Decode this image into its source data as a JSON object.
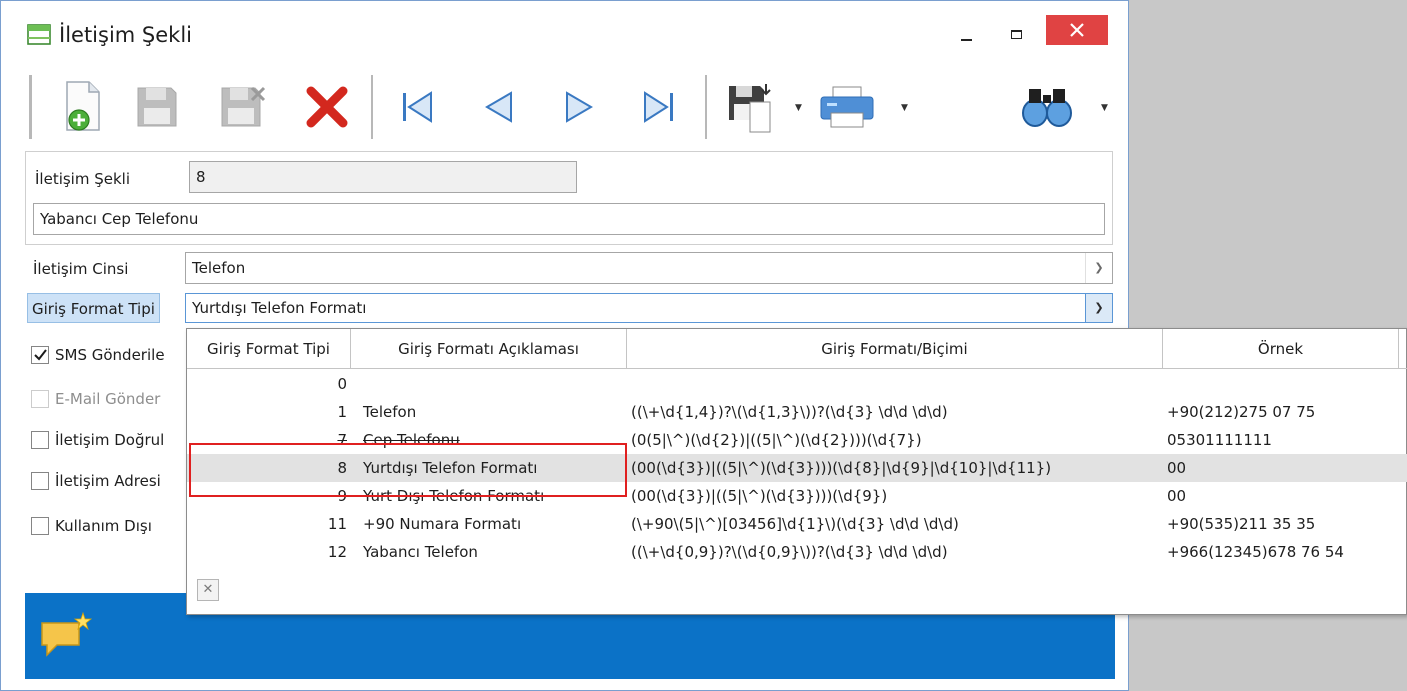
{
  "window": {
    "title": "İletişim Şekli",
    "buttons": {
      "minimize": "_",
      "maximize": "□",
      "close": "✕"
    }
  },
  "toolbar": {
    "items": [
      "new-icon",
      "save-icon",
      "save-close-icon",
      "delete-icon",
      "first-record-icon",
      "previous-record-icon",
      "next-record-icon",
      "last-record-icon",
      "export-icon",
      "print-icon",
      "find-icon"
    ]
  },
  "form": {
    "id_label": "İletişim Şekli",
    "id_value": "8",
    "name_value": "Yabancı Cep Telefonu",
    "type_label": "İletişim Cinsi",
    "type_value": "Telefon",
    "format_label": "Giriş Format Tipi",
    "format_value": "Yurtdışı Telefon Formatı",
    "checkboxes": [
      {
        "label": "SMS Gönderile",
        "checked": true,
        "enabled": true
      },
      {
        "label": "E-Mail Gönder",
        "checked": false,
        "enabled": false
      },
      {
        "label": "İletişim Doğrul",
        "checked": false,
        "enabled": true
      },
      {
        "label": "İletişim Adresi",
        "checked": false,
        "enabled": true
      },
      {
        "label": "Kullanım Dışı",
        "checked": false,
        "enabled": true
      }
    ]
  },
  "popup": {
    "headers": [
      "Giriş Format Tipi",
      "Giriş Formatı Açıklaması",
      "Giriş Formatı/Biçimi",
      "Örnek"
    ],
    "rows": [
      {
        "id": "0",
        "desc": "",
        "format": "",
        "example": ""
      },
      {
        "id": "1",
        "desc": "Telefon",
        "format": "((\\+\\d{1,4})?\\(\\d{1,3}\\))?(\\d{3} \\d\\d \\d\\d)",
        "example": "+90(212)275 07 75"
      },
      {
        "id": "7",
        "desc": "Cep Telefonu",
        "format": "(0(5|\\^)(\\d{2})|((5|\\^)(\\d{2})))(\\d{7})",
        "example": "05301111111"
      },
      {
        "id": "8",
        "desc": "Yurtdışı Telefon Formatı",
        "format": "(00(\\d{3})|((5|\\^)(\\d{3})))(\\d{8}|\\d{9}|\\d{10}|\\d{11})",
        "example": "00"
      },
      {
        "id": "9",
        "desc": "Yurt Dışı Telefon Formatı",
        "format": "(00(\\d{3})|((5|\\^)(\\d{3})))(\\d{9})",
        "example": "00"
      },
      {
        "id": "11",
        "desc": "+90 Numara Formatı",
        "format": "(\\+90\\(5|\\^)[03456]\\d{1}\\)(\\d{3} \\d\\d \\d\\d)",
        "example": "+90(535)211 35 35"
      },
      {
        "id": "12",
        "desc": "Yabancı Telefon",
        "format": "((\\+\\d{0,9})?\\(\\d{0,9}\\))?(\\d{3} \\d\\d \\d\\d)",
        "example": "+966(12345)678 76 54"
      }
    ],
    "selected_row_id": "8",
    "close_glyph": "✕"
  },
  "colors": {
    "accent_blue": "#0b72c7",
    "close_red": "#e04343",
    "highlight_red": "#e02020",
    "selected_row": "#e2e2e2",
    "label_highlight": "#cde2f7"
  }
}
